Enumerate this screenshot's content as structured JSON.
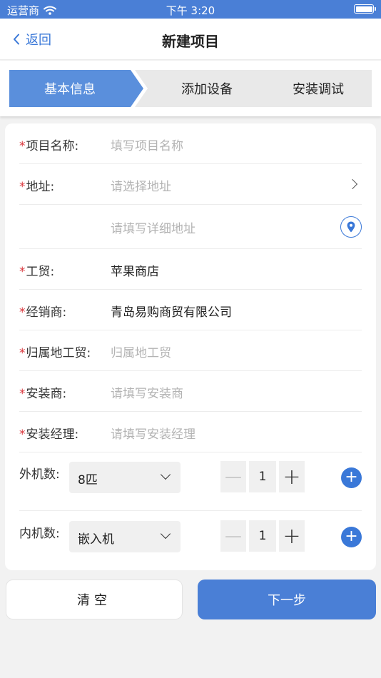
{
  "status_bar": {
    "carrier": "运营商",
    "time": "下午 3:20"
  },
  "nav": {
    "back_label": "返回",
    "title": "新建项目"
  },
  "steps": [
    {
      "label": "基本信息",
      "active": true
    },
    {
      "label": "添加设备",
      "active": false
    },
    {
      "label": "安装调试",
      "active": false
    }
  ],
  "form": {
    "project_name": {
      "label": "项目名称:",
      "placeholder": "填写项目名称"
    },
    "address": {
      "label": "地址:",
      "placeholder": "请选择地址"
    },
    "address_detail": {
      "placeholder": "请填写详细地址"
    },
    "gongmao": {
      "label": "工贸:",
      "value": "苹果商店"
    },
    "dealer": {
      "label": "经销商:",
      "value": "青岛易购商贸有限公司"
    },
    "home_gongmao": {
      "label": "归属地工贸:",
      "placeholder": "归属地工贸"
    },
    "installer": {
      "label": "安装商:",
      "placeholder": "请填写安装商"
    },
    "install_manager": {
      "label": "安装经理:",
      "placeholder": "请填写安装经理"
    },
    "outdoor": {
      "label": "外机数:",
      "selected": "8匹",
      "qty": "1"
    },
    "indoor": {
      "label": "内机数:",
      "selected": "嵌入机",
      "qty": "1"
    }
  },
  "buttons": {
    "clear": "清空",
    "next": "下一步"
  },
  "colors": {
    "accent": "#4a7fd6",
    "required": "#d9343a",
    "placeholder": "#b3b3b3"
  }
}
